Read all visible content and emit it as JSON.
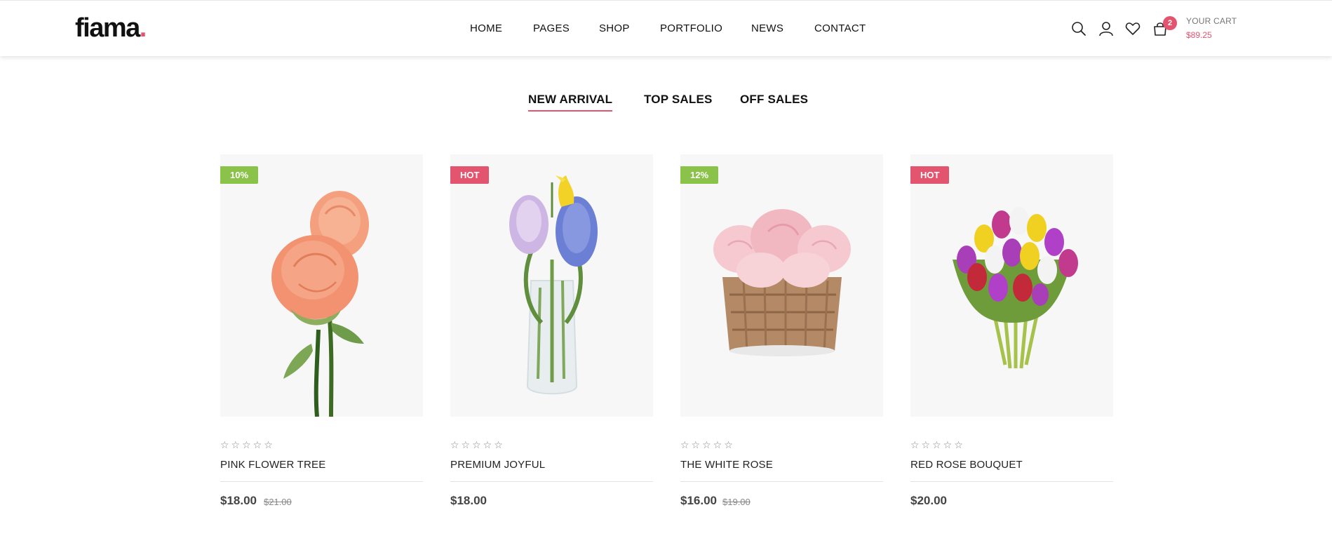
{
  "brand": {
    "logo_text": "fiama",
    "logo_dot": ".",
    "accent_color": "#e3546f",
    "green_color": "#8bc34a"
  },
  "nav": {
    "items": [
      {
        "label": "HOME"
      },
      {
        "label": "PAGES"
      },
      {
        "label": "SHOP"
      },
      {
        "label": "PORTFOLIO"
      },
      {
        "label": "NEWS"
      },
      {
        "label": "CONTACT"
      }
    ]
  },
  "header_icons": {
    "search": "search-icon",
    "account": "user-icon",
    "wishlist": "heart-icon",
    "cart": "shopping-bag-icon"
  },
  "cart": {
    "count": "2",
    "label": "YOUR CART",
    "total": "$89.25"
  },
  "tabs": [
    {
      "label": "NEW ARRIVAL",
      "active": true
    },
    {
      "label": "TOP SALES",
      "active": false
    },
    {
      "label": "OFF SALES",
      "active": false
    }
  ],
  "products": [
    {
      "badge": "10%",
      "badge_type": "discount",
      "rating": "☆☆☆☆☆",
      "name": "PINK FLOWER TREE",
      "price": "$18.00",
      "old_price": "$21.00",
      "image": "orange roses"
    },
    {
      "badge": "HOT",
      "badge_type": "hot",
      "rating": "☆☆☆☆☆",
      "name": "PREMIUM JOYFUL",
      "price": "$18.00",
      "old_price": "",
      "image": "hyacinth in glass vase"
    },
    {
      "badge": "12%",
      "badge_type": "discount",
      "rating": "☆☆☆☆☆",
      "name": "THE WHITE ROSE",
      "price": "$16.00",
      "old_price": "$19.00",
      "image": "pink roses in wicker basket"
    },
    {
      "badge": "HOT",
      "badge_type": "hot",
      "rating": "☆☆☆☆☆",
      "name": "RED ROSE BOUQUET",
      "price": "$20.00",
      "old_price": "",
      "image": "tulip bouquet"
    }
  ]
}
